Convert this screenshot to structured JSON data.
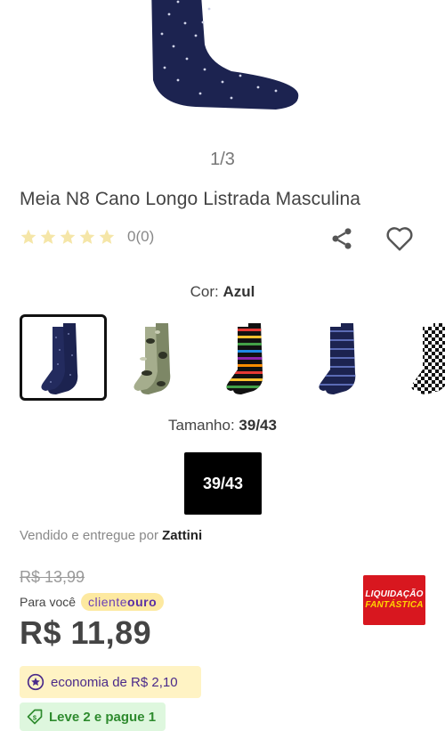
{
  "gallery": {
    "pager": "1/3"
  },
  "product": {
    "title": "Meia N8 Cano Longo Listrada Masculina",
    "rating": {
      "stars": 0,
      "max": 5,
      "count_text": "0(0)"
    }
  },
  "actions": {
    "share_icon": "share-icon",
    "favorite_icon": "heart-icon"
  },
  "color": {
    "label": "Cor:",
    "value": "Azul",
    "swatches": [
      {
        "name": "navy-dots",
        "selected": true
      },
      {
        "name": "camo",
        "selected": false
      },
      {
        "name": "rainbow-stripes",
        "selected": false
      },
      {
        "name": "navy-stripes",
        "selected": false
      },
      {
        "name": "checkered",
        "selected": false
      }
    ]
  },
  "size": {
    "label": "Tamanho:",
    "value": "39/43",
    "option": "39/43"
  },
  "seller": {
    "prefix": "Vendido e entregue por",
    "name": "Zattini"
  },
  "pricing": {
    "old_price": "R$ 13,99",
    "para_voce": "Para você",
    "cliente_ouro_a": "cliente",
    "cliente_ouro_b": "ouro",
    "price": "R$ 11,89",
    "economia": "economia de R$ 2,10",
    "leve": "Leve 2 e pague 1"
  },
  "promo": {
    "line1": "LIQUIDAÇÃO",
    "line2": "FANTÁSTICA"
  },
  "colors": {
    "accent_purple": "#4a2a8a",
    "promo_red": "#d8171f",
    "green": "#2e8b2e",
    "star": "#f5e6a8"
  }
}
